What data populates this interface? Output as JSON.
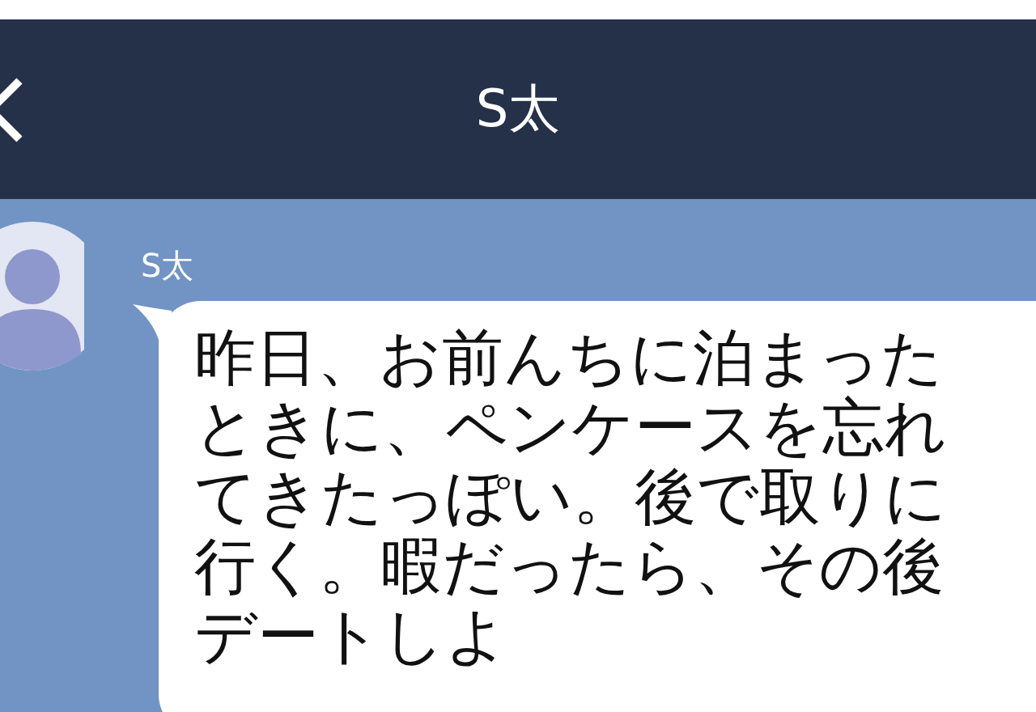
{
  "header": {
    "title": "S太"
  },
  "messages": [
    {
      "sender": "S太",
      "text": "昨日、お前んちに泊まったときに、ペンケースを忘れてきたっぽい。後で取りに行く。暇だったら、その後デートしよ"
    }
  ]
}
